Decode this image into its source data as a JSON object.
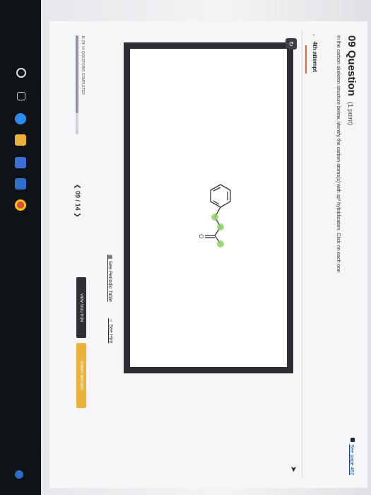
{
  "question": {
    "number": "09",
    "label": "Question",
    "points": "(1 point)",
    "text": "In the carbon skeleton structure below, identify the carbon atoms(s) with sp³ hybridization. Click on each one.",
    "see_page": "See page 462"
  },
  "attempt": {
    "label": "4th attempt"
  },
  "tools": {
    "periodic_table": "See Periodic Table",
    "hint": "See Hint"
  },
  "navigation": {
    "label": "09 / 14"
  },
  "progress": {
    "text": "11 OF 14 QUESTIONS COMPLETED",
    "fraction": 0.7857
  },
  "buttons": {
    "view_solution": "VIEW SOLUTION",
    "submit": "SUBMIT ANSWER"
  },
  "molecule": {
    "atom_label": "O",
    "highlight_color": "#8fd16a"
  },
  "colors": {
    "accent": "#e0663b",
    "submit": "#e9b23a",
    "link": "#1a4a8a"
  },
  "taskbar": {
    "icons": [
      "windows-icon",
      "search-icon",
      "taskview-icon",
      "edge-icon",
      "files-icon",
      "store-icon",
      "mail-icon",
      "chrome-icon"
    ]
  }
}
